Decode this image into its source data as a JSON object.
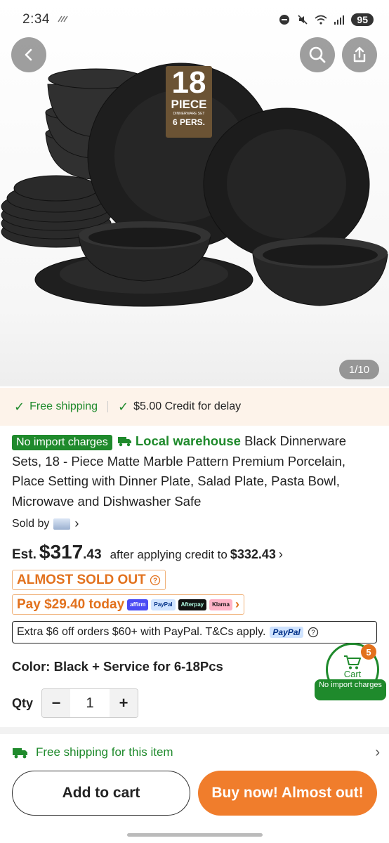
{
  "status_bar": {
    "time": "2:34",
    "battery": "95"
  },
  "product": {
    "image_counter": "1/10",
    "hero_badge": {
      "number": "18",
      "word": "PIECE",
      "small": "DINNERWARE SET",
      "pers": "6 PERS."
    },
    "badge_no_import": "No import charges",
    "local_warehouse": "Local warehouse",
    "title": "Black Dinnerware Sets, 18 - Piece Matte Marble Pattern Premium Porcelain, Place Setting with Dinner Plate, Salad Plate, Pasta Bowl, Microwave and Dishwasher Safe",
    "sold_by_label": "Sold by"
  },
  "shipping_strip": {
    "free_shipping": "Free shipping",
    "credit": "$5.00 Credit for delay"
  },
  "price": {
    "est_label": "Est.",
    "currency": "$",
    "whole": "317",
    "cents": ".43",
    "after_credit_label": "after applying credit to",
    "credit_price": "$332.43"
  },
  "almost_sold_out": "ALMOST SOLD OUT",
  "pay_today": "Pay $29.40 today",
  "pay_logos": [
    "affirm",
    "PayPal",
    "Afterpay",
    "Klarna"
  ],
  "paypal_promo": {
    "text": "Extra $6 off orders $60+ with PayPal. T&Cs apply.",
    "logo": "PayPal"
  },
  "color_label": "Color: Black + Service for 6-18Pcs",
  "qty": {
    "label": "Qty",
    "value": "1",
    "minus": "−",
    "plus": "+"
  },
  "floating_cart": {
    "label": "Cart",
    "count": "5",
    "badge": "No import charges"
  },
  "free_shipping_item": "Free shipping for this item",
  "buttons": {
    "add_to_cart": "Add to cart",
    "buy_now": "Buy now! Almost out!"
  },
  "colors": {
    "green": "#1f8a2c",
    "orange": "#f07d2c",
    "alert_orange": "#e2711d"
  }
}
